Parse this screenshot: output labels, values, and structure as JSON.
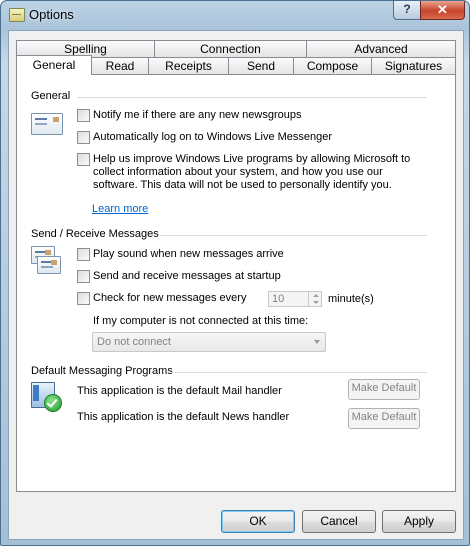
{
  "window": {
    "title": "Options",
    "help_label": "?",
    "close_label": "✕"
  },
  "tabs_row1": [
    {
      "label": "Spelling"
    },
    {
      "label": "Connection"
    },
    {
      "label": "Advanced"
    }
  ],
  "tabs_row2": [
    {
      "label": "General"
    },
    {
      "label": "Read"
    },
    {
      "label": "Receipts"
    },
    {
      "label": "Send"
    },
    {
      "label": "Compose"
    },
    {
      "label": "Signatures"
    }
  ],
  "active_tab": "General",
  "general": {
    "heading": "General",
    "notify_label": "Notify me if there are any new newsgroups",
    "auto_logon_label": "Automatically log on to Windows Live Messenger",
    "help_improve_label": "Help us improve Windows Live programs by allowing Microsoft to collect information about your system, and how you use our software. This data will not be used to personally identify you.",
    "learn_more": "Learn more"
  },
  "send_receive": {
    "heading": "Send / Receive Messages",
    "play_sound_label": "Play sound when new messages arrive",
    "send_receive_startup_label": "Send and receive messages at startup",
    "check_every_label": "Check for new messages every",
    "interval_value": "10",
    "interval_unit": "minute(s)",
    "not_connected_label": "If my computer is not connected at this time:",
    "not_connected_value": "Do not connect"
  },
  "default_programs": {
    "heading": "Default Messaging Programs",
    "mail_label": "This application is the default Mail handler",
    "news_label": "This application is the default News handler",
    "make_default_mail": "Make Default",
    "make_default_news": "Make Default"
  },
  "footer": {
    "ok": "OK",
    "cancel": "Cancel",
    "apply": "Apply"
  }
}
